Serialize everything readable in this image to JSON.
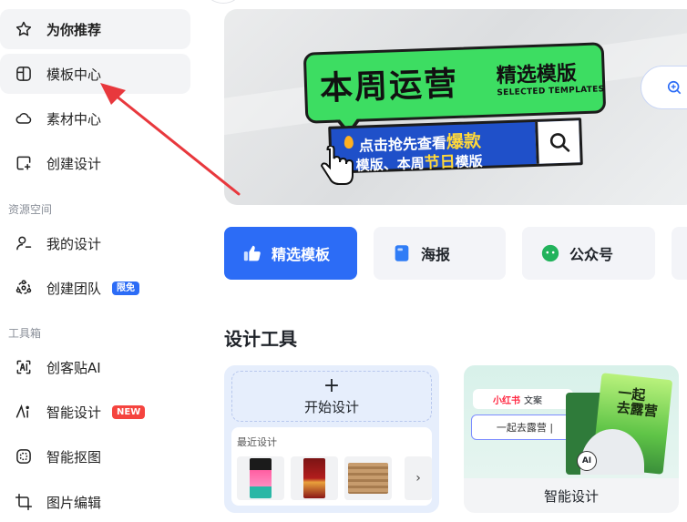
{
  "sidebar": {
    "items": [
      {
        "label": "为你推荐",
        "icon": "star-icon"
      },
      {
        "label": "模板中心",
        "icon": "template-icon"
      },
      {
        "label": "素材中心",
        "icon": "cloud-icon"
      },
      {
        "label": "创建设计",
        "icon": "add-design-icon"
      },
      {
        "label": "我的设计",
        "icon": "user-icon"
      },
      {
        "label": "创建团队",
        "icon": "team-icon",
        "badge": "限免"
      },
      {
        "label": "创客贴AI",
        "icon": "ai-scan-icon"
      },
      {
        "label": "智能设计",
        "icon": "ai-design-icon",
        "badge": "NEW"
      },
      {
        "label": "智能抠图",
        "icon": "cutout-icon"
      },
      {
        "label": "图片编辑",
        "icon": "crop-icon"
      }
    ],
    "sections": {
      "resources": "资源空间",
      "toolbox": "工具箱"
    }
  },
  "banner": {
    "title": "本周运营",
    "subtitle": "精选模版",
    "subtitle_en": "SELECTED TEMPLATES",
    "line1_pre": "点击抢先查看",
    "line1_hl": "爆款",
    "line2_pre": "模版、本周",
    "line2_hl": "节日",
    "line2_post": "模版"
  },
  "tabs": [
    {
      "label": "精选模板",
      "icon": "thumbs-up-icon"
    },
    {
      "label": "海报",
      "icon": "poster-icon"
    },
    {
      "label": "公众号",
      "icon": "wechat-icon"
    }
  ],
  "design_tools": {
    "title": "设计工具",
    "start_label": "开始设计",
    "plus": "+",
    "recent_label": "最近设计",
    "more": "›",
    "ai_card": {
      "caption": "智能设计",
      "xhs_brand": "小红书",
      "xhs_suffix": "文案",
      "input_text": "一起去露营 |",
      "poster_text": "一起\n去露营",
      "ai_badge": "AI"
    }
  },
  "colors": {
    "primary": "#2c6cf6",
    "arrow": "#e8383d",
    "banner_green": "#3ddd62",
    "banner_blue": "#1f50c9",
    "highlight": "#ffd83a"
  }
}
